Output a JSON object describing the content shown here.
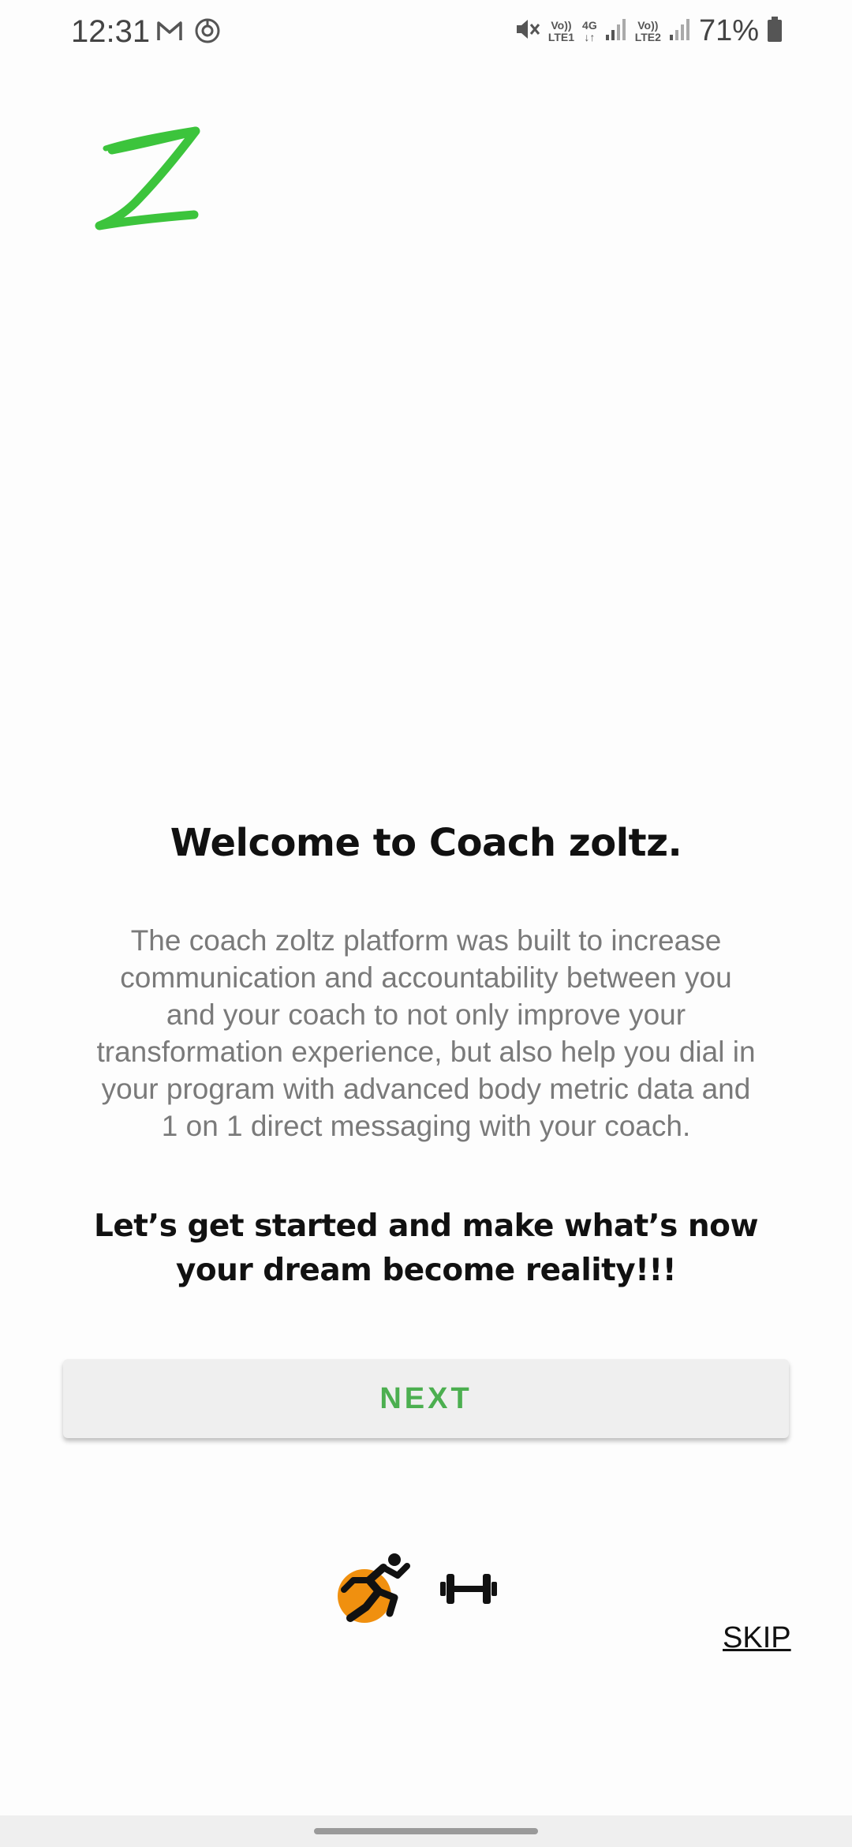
{
  "status_bar": {
    "time": "12:31",
    "left_icons": [
      "gmail-icon",
      "sync-circle-icon"
    ],
    "right_icons": [
      "mute-icon",
      "volte1-icon",
      "4g-icon",
      "signal1-icon",
      "volte2-icon",
      "signal2-icon",
      "battery-icon"
    ],
    "sim1_label_top": "Vo))",
    "sim1_label_bottom": "LTE1",
    "network_label_top": "4G",
    "network_label_bottom": "↓↑",
    "sim2_label_top": "Vo))",
    "sim2_label_bottom": "LTE2",
    "battery_percent": "71%"
  },
  "logo": {
    "icon": "z-logo-icon",
    "color": "#3cc43c"
  },
  "welcome": {
    "title": "Welcome to Coach zoltz.",
    "body": "The coach zoltz platform was built to increase communication and accountability between you and your coach to not only improve your transformation experience, but also help you dial in your program with advanced body metric data and 1 on 1 direct messaging with your coach.",
    "cta": "Let’s get started and make what’s now your dream become reality!!!"
  },
  "actions": {
    "next_label": "NEXT",
    "skip_label": "SKIP"
  },
  "bottom_icons": {
    "runner": "runner-icon",
    "dumbbell": "dumbbell-icon"
  },
  "colors": {
    "accent_green": "#4caf50",
    "logo_green": "#3cc43c",
    "runner_orange": "#f0900f"
  }
}
